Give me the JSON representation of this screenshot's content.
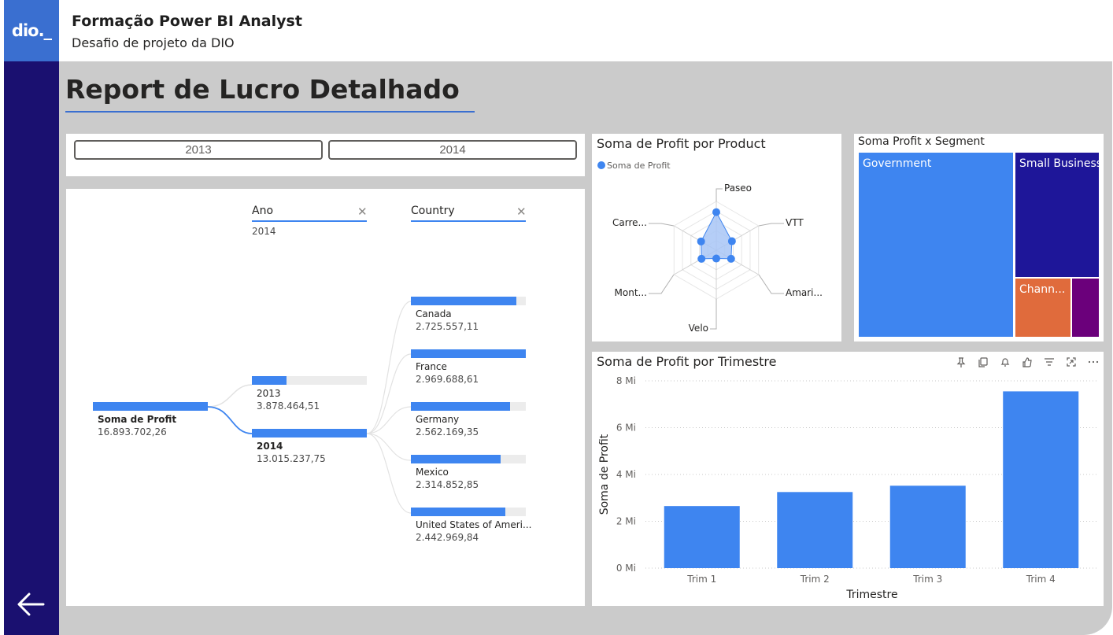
{
  "app": {
    "logo": "dio._",
    "title": "Formação Power BI Analyst",
    "subtitle": "Desafio de projeto da DIO"
  },
  "report": {
    "title": "Report de Lucro Detalhado"
  },
  "slicer": {
    "options": [
      "2013",
      "2014"
    ]
  },
  "decomposition_tree": {
    "levels": [
      {
        "header": "Ano",
        "filter": "2014"
      },
      {
        "header": "Country",
        "filter": ""
      }
    ],
    "root": {
      "label": "Soma de Profit",
      "value": "16.893.702,26"
    },
    "years": [
      {
        "label": "2013",
        "value": "3.878.464,51",
        "fill": 0.3
      },
      {
        "label": "2014",
        "value": "13.015.237,75",
        "fill": 1.0
      }
    ],
    "countries": [
      {
        "label": "Canada",
        "value": "2.725.557,11",
        "fill": 0.918
      },
      {
        "label": "France",
        "value": "2.969.688,61",
        "fill": 1.0
      },
      {
        "label": "Germany",
        "value": "2.562.169,35",
        "fill": 0.863
      },
      {
        "label": "Mexico",
        "value": "2.314.852,85",
        "fill": 0.78
      },
      {
        "label": "United States of Ameri...",
        "value": "2.442.969,84",
        "fill": 0.823
      }
    ]
  },
  "radar": {
    "title": "Soma de Profit por Product",
    "legend": "Soma de Profit",
    "colors": {
      "series": "#3e85f0",
      "fill": "#a8c6f6"
    },
    "axes": [
      "Paseo",
      "VTT",
      "Amari...",
      "Velo",
      "Mont...",
      "Carre..."
    ],
    "values": [
      0.78,
      0.37,
      0.35,
      0.17,
      0.35,
      0.36
    ]
  },
  "treemap": {
    "title": "Soma Profit x Segment",
    "cells": [
      {
        "label": "Government",
        "color": "#3e85f0"
      },
      {
        "label": "Small Business",
        "color": "#1e1699"
      },
      {
        "label": "Chann...",
        "color": "#e06b3c"
      },
      {
        "label": "",
        "color": "#6b007b"
      }
    ]
  },
  "chart_data": {
    "type": "bar",
    "title": "Soma de Profit por Trimestre",
    "categories": [
      "Trim 1",
      "Trim 2",
      "Trim 3",
      "Trim 4"
    ],
    "values": [
      2.65,
      3.25,
      3.52,
      7.55
    ],
    "xlabel": "Trimestre",
    "ylabel": "Soma de Profit",
    "yticks": [
      "0 Mi",
      "2 Mi",
      "4 Mi",
      "6 Mi",
      "8 Mi"
    ],
    "ylim": [
      0,
      8
    ],
    "grid": true,
    "color": "#3e85f0"
  },
  "visual_header_icons": [
    "pin-icon",
    "copy-icon",
    "bell-icon",
    "like-icon",
    "filter-icon",
    "focus-mode-icon",
    "more-options-icon"
  ]
}
